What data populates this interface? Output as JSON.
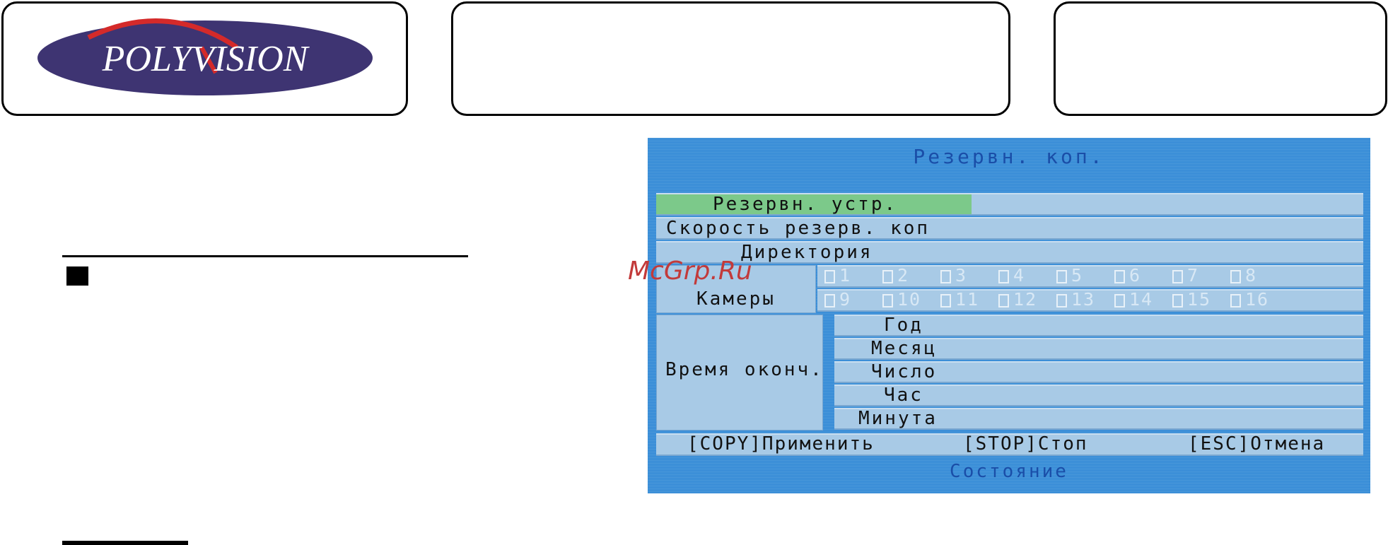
{
  "brand": {
    "logo_text": "POLYVISION"
  },
  "watermark": "McGrp.Ru",
  "osd": {
    "title": "Резервн. коп.",
    "rows": {
      "backup_device": "Резервн. устр.",
      "backup_speed": "Скорость резерв. коп",
      "directory": "Директория",
      "cameras": "Камеры",
      "end_time": "Время оконч.",
      "year": "Год",
      "month": "Месяц",
      "day": "Число",
      "hour": "Час",
      "minute": "Минута"
    },
    "camera_channels_row1": [
      "1",
      "2",
      "3",
      "4",
      "5",
      "6",
      "7",
      "8"
    ],
    "camera_channels_row2": [
      "9",
      "10",
      "11",
      "12",
      "13",
      "14",
      "15",
      "16"
    ],
    "footer": {
      "apply": "[COPY]Применить",
      "stop": "[STOP]Стоп",
      "cancel": "[ESC]Отмена"
    },
    "status": "Состояние"
  },
  "colors": {
    "osd_background": "#3c8fd8",
    "row_fill": "#a8cae6",
    "selected_row": "#7cc98a",
    "title_text": "#1a4ea8",
    "logo_oval": "#3e3472",
    "logo_swoosh": "#d42a2a",
    "watermark": "#c23a3a"
  }
}
